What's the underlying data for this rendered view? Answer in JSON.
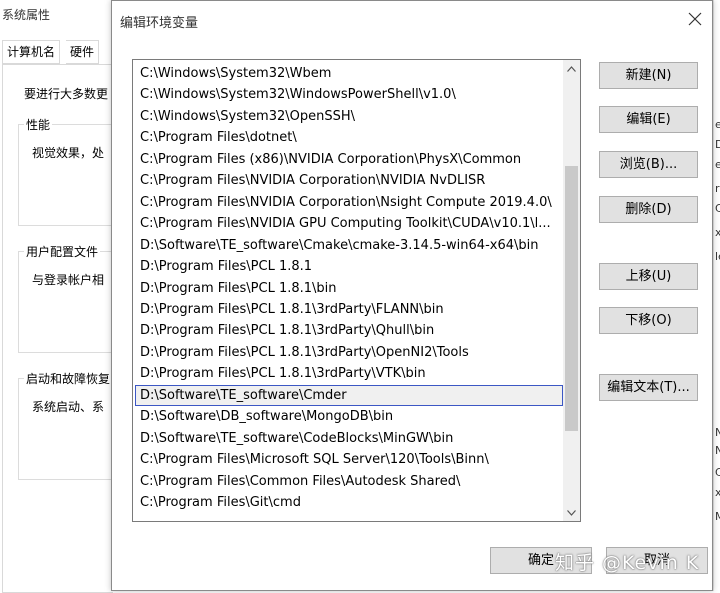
{
  "background_window": {
    "title": "系统属性",
    "tabs": [
      "计算机名",
      "硬件"
    ],
    "intro_text": "要进行大多数更",
    "performance": {
      "label": "性能",
      "text": "视觉效果，处"
    },
    "user_profiles": {
      "label": "用户配置文件",
      "text": "与登录帐户相"
    },
    "startup": {
      "label": "启动和故障恢复",
      "text": "系统启动、系"
    },
    "right_edge_chars": [
      "e",
      "D",
      "er",
      "r",
      "C",
      "x",
      "le",
      "N",
      "N",
      "C",
      "x",
      "M"
    ]
  },
  "dialog": {
    "title": "编辑环境变量",
    "close_icon": "close-icon",
    "paths": [
      "C:\\Windows\\System32\\Wbem",
      "C:\\Windows\\System32\\WindowsPowerShell\\v1.0\\",
      "C:\\Windows\\System32\\OpenSSH\\",
      "C:\\Program Files\\dotnet\\",
      "C:\\Program Files (x86)\\NVIDIA Corporation\\PhysX\\Common",
      "C:\\Program Files\\NVIDIA Corporation\\NVIDIA NvDLISR",
      "C:\\Program Files\\NVIDIA Corporation\\Nsight Compute 2019.4.0\\",
      "C:\\Program Files\\NVIDIA GPU Computing Toolkit\\CUDA\\v10.1\\l...",
      "D:\\Software\\TE_software\\Cmake\\cmake-3.14.5-win64-x64\\bin",
      "D:\\Program Files\\PCL 1.8.1",
      "D:\\Program Files\\PCL 1.8.1\\bin",
      "D:\\Program Files\\PCL 1.8.1\\3rdParty\\FLANN\\bin",
      "D:\\Program Files\\PCL 1.8.1\\3rdParty\\Qhull\\bin",
      "D:\\Program Files\\PCL 1.8.1\\3rdParty\\OpenNI2\\Tools",
      "D:\\Program Files\\PCL 1.8.1\\3rdParty\\VTK\\bin",
      "D:\\Software\\TE_software\\Cmder",
      "D:\\Software\\DB_software\\MongoDB\\bin",
      "D:\\Software\\TE_software\\CodeBlocks\\MinGW\\bin",
      "C:\\Program Files\\Microsoft SQL Server\\120\\Tools\\Binn\\",
      "C:\\Program Files\\Common Files\\Autodesk Shared\\",
      "C:\\Program Files\\Git\\cmd"
    ],
    "selected_index": 15,
    "scrollbar": {
      "position_fraction": 0.55,
      "visible_fraction": 0.62
    },
    "buttons": {
      "new": "新建(N)",
      "edit": "编辑(E)",
      "browse": "浏览(B)...",
      "delete": "删除(D)",
      "move_up": "上移(U)",
      "move_down": "下移(O)",
      "edit_text": "编辑文本(T)...",
      "ok": "确定",
      "cancel": "取消"
    }
  },
  "watermark": "知乎 @Kevin K"
}
